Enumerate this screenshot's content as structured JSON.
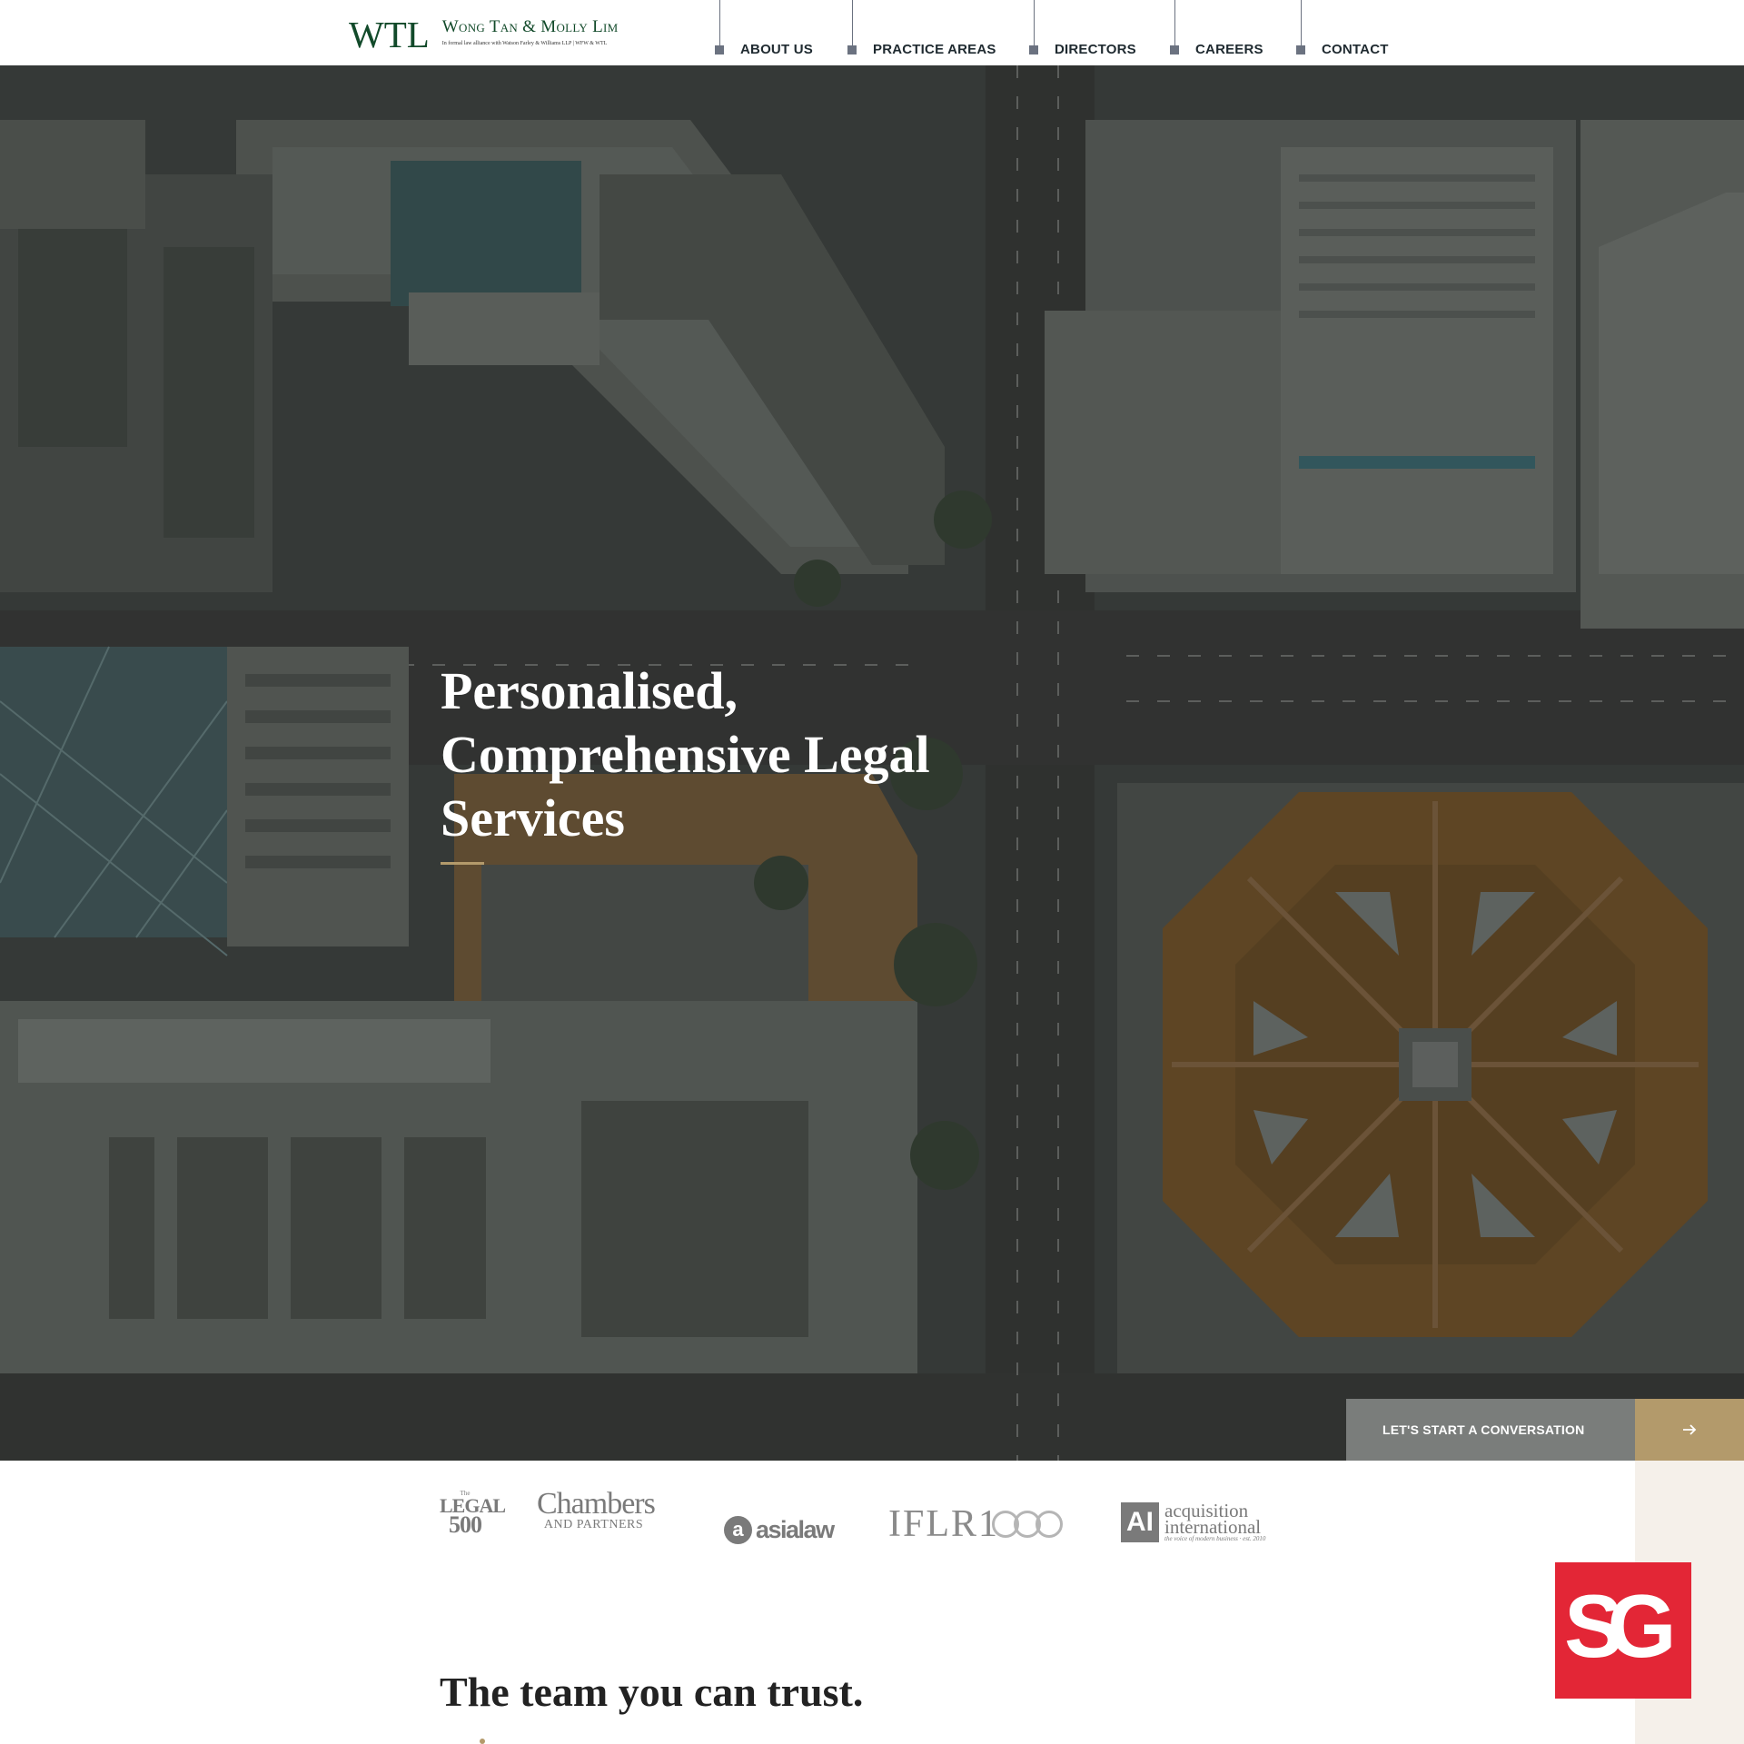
{
  "brand": {
    "mark": "WTL",
    "name": "Wong Tan & Molly Lim",
    "tagline": "In formal law alliance with Watson Farley & Williams LLP | WFW & WTL",
    "primary_color": "#124a2a",
    "accent_color": "#b39a6b"
  },
  "nav": {
    "items": [
      {
        "label": "ABOUT US"
      },
      {
        "label": "PRACTICE AREAS"
      },
      {
        "label": "DIRECTORS"
      },
      {
        "label": "CAREERS"
      },
      {
        "label": "CONTACT"
      }
    ]
  },
  "hero": {
    "title": "Personalised, Comprehensive Legal Services",
    "background": "aerial-city-photo"
  },
  "cta": {
    "label": "LET'S START A CONVERSATION",
    "icon": "arrow-right-icon"
  },
  "awards": {
    "legal500": {
      "the": "The",
      "legal": "LEGAL",
      "num": "500"
    },
    "chambers": {
      "big": "Chambers",
      "small": "AND PARTNERS"
    },
    "asialaw": {
      "badge": "a",
      "word": "asialaw"
    },
    "iflr": {
      "text": "IFLR1"
    },
    "ai": {
      "box": "AI",
      "line1": "acquisition",
      "line2": "international",
      "line3": "the voice of modern business · est. 2010"
    }
  },
  "sg_badge": {
    "text": "SG"
  },
  "team": {
    "title": "The team you can trust."
  }
}
